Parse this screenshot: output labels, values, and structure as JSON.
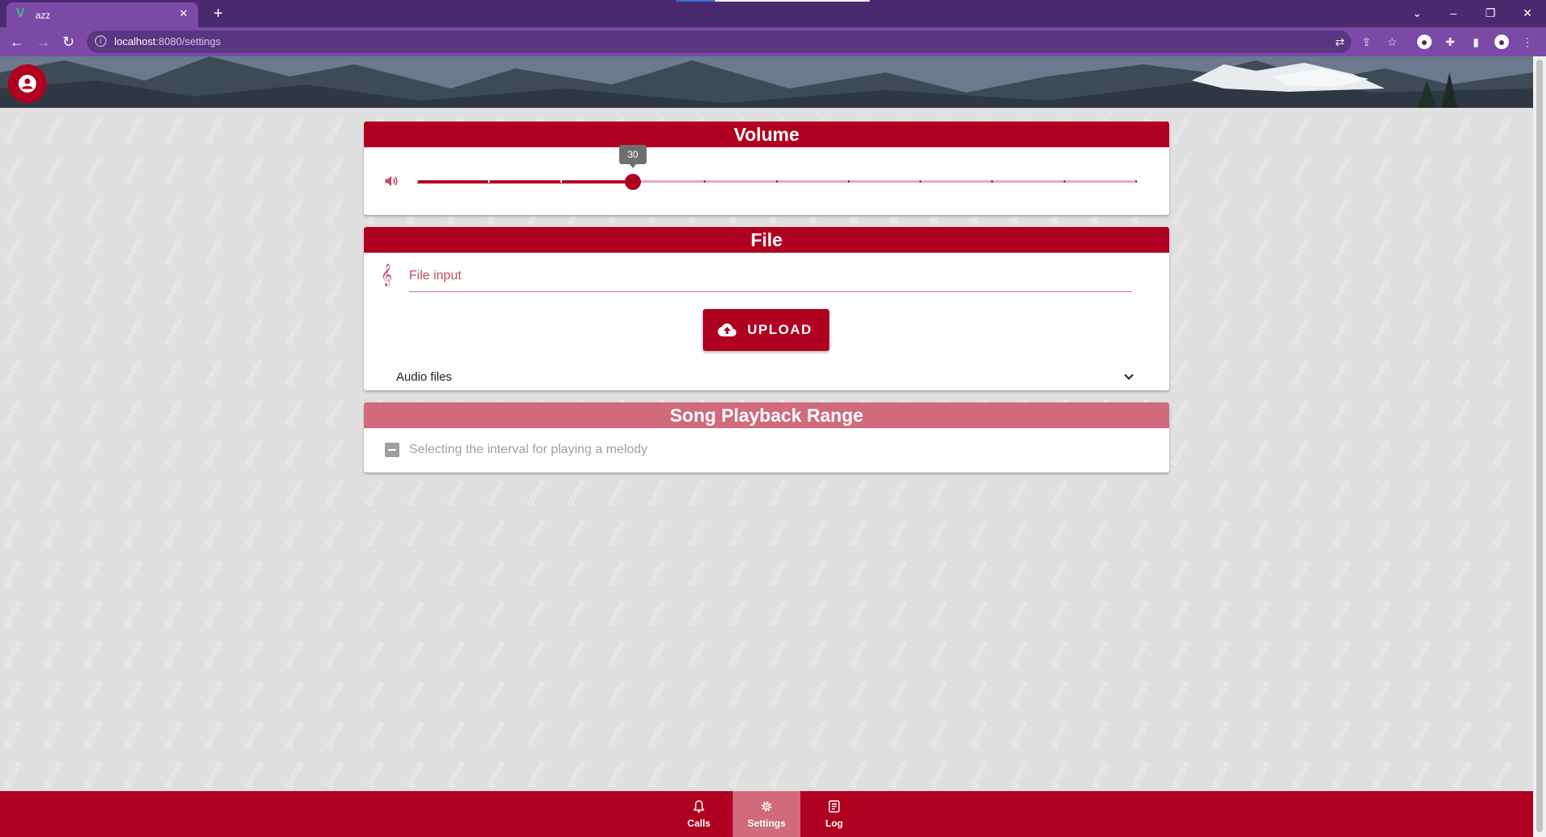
{
  "browser": {
    "tab_title": "azz",
    "favicon": "V",
    "url_host": "localhost",
    "url_path": ":8080/settings"
  },
  "volume": {
    "title": "Volume",
    "value": 30,
    "value_label": "30",
    "min": 0,
    "max": 100,
    "step": 10
  },
  "file": {
    "title": "File",
    "input_placeholder": "File input",
    "upload_label": "UPLOAD",
    "audio_files_label": "Audio files"
  },
  "playback": {
    "title": "Song Playback Range",
    "checkbox_label": "Selecting the interval for playing a melody"
  },
  "watermark_text": "goose",
  "nav": {
    "items": [
      {
        "label": "Calls",
        "icon": "bell-icon"
      },
      {
        "label": "Settings",
        "icon": "gear-icon",
        "active": true
      },
      {
        "label": "Log",
        "icon": "log-icon"
      }
    ]
  },
  "colors": {
    "primary": "#b00020",
    "primary_light": "#d16a7c",
    "browser_frame": "#4a2a6e"
  }
}
